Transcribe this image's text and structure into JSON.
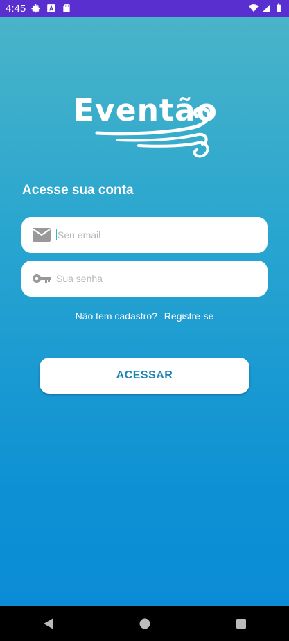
{
  "status_bar": {
    "time": "4:45",
    "icons": [
      "settings-icon",
      "a-icon",
      "sd-card-icon",
      "wifi-icon",
      "signal-icon",
      "battery-icon"
    ],
    "color": "#5a2fd0"
  },
  "logo": {
    "text": "Eventão"
  },
  "login": {
    "heading": "Acesse sua conta",
    "email_placeholder": "Seu email",
    "password_placeholder": "Sua senha",
    "no_account_text": "Não tem cadastro?",
    "register_link": "Registre-se",
    "submit_label": "ACESSAR"
  },
  "theme": {
    "gradient_top": "#4ab4c8",
    "gradient_bottom": "#0b8cd6",
    "button_text_color": "#1c84b4"
  },
  "nav_bar": {
    "icons": [
      "back-icon",
      "home-icon",
      "recents-icon"
    ]
  }
}
